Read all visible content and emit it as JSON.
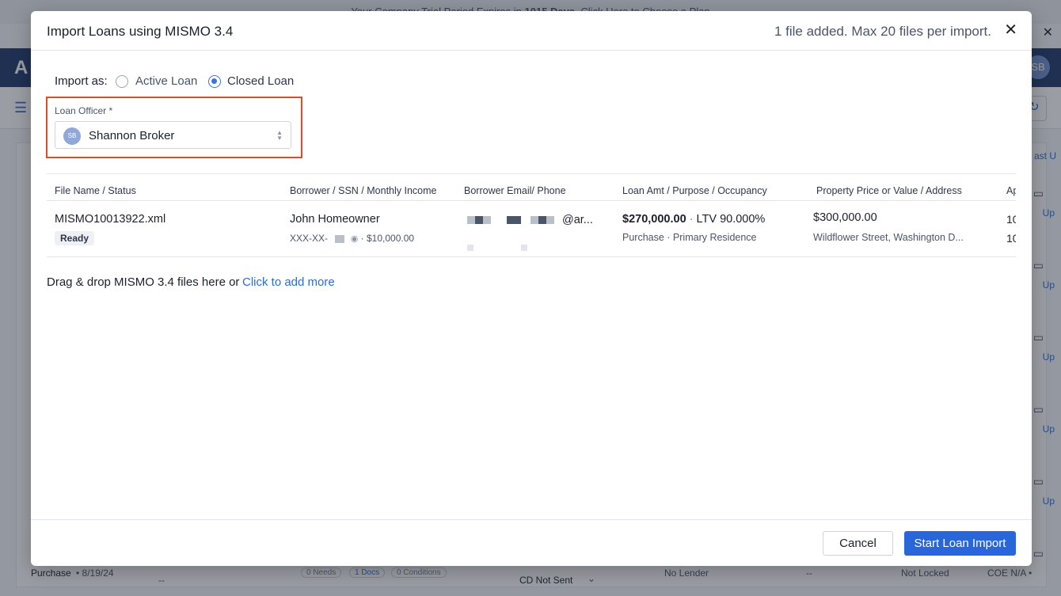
{
  "background": {
    "banner_pre": "Your Company Trial Period Expires in ",
    "banner_days": "1015 Days",
    "banner_post": ". Click Here to Choose a Plan",
    "brand_letter": "A",
    "avatar_initials": "SB",
    "last_u_link": "ast U",
    "side_link": "Up",
    "bottom_row": {
      "purpose": "Purchase",
      "date": " • 8/19/24",
      "dash1": "--",
      "needs": "0 Needs",
      "docs": "1 Docs",
      "conditions": "0 Conditions",
      "cd_status": "CD Not Sent",
      "lender": "No Lender",
      "dash2": "--",
      "lock": "Not Locked",
      "coe": "COE N/A •"
    }
  },
  "modal": {
    "title": "Import Loans using MISMO 3.4",
    "file_count": "1 file added. Max 20 files per import.",
    "close_glyph": "✕",
    "import_as": {
      "label": "Import as:",
      "options": [
        {
          "label": "Active Loan",
          "selected": false
        },
        {
          "label": "Closed Loan",
          "selected": true
        }
      ]
    },
    "loan_officer": {
      "label": "Loan Officer *",
      "initials": "SB",
      "value": "Shannon Broker"
    },
    "table": {
      "headers": [
        "File Name / Status",
        "Borrower / SSN / Monthly Income",
        "Borrower Email/ Phone",
        "Loan Amt / Purpose / Occupancy",
        "Property Price or Value / Address",
        "Ap"
      ],
      "rows": [
        {
          "file_name": "MISMO10013922.xml",
          "status": "Ready",
          "borrower": "John Homeowner",
          "ssn_prefix": "XXX-XX-",
          "income": "$10,000.00",
          "email_suffix": "@ar...",
          "loan_amount": "$270,000.00",
          "ltv": "LTV 90.000%",
          "purpose": "Purchase",
          "occupancy": "Primary Residence",
          "property_price": "$300,000.00",
          "address": "Wildflower Street, Washington D...",
          "ap_1": "10",
          "ap_2": "10"
        }
      ]
    },
    "dropzone": {
      "text": "Drag & drop MISMO 3.4 files here or",
      "link": "Click to add more"
    },
    "footer": {
      "cancel": "Cancel",
      "start": "Start Loan Import"
    }
  },
  "colors": {
    "primary": "#2866d9",
    "highlight_border": "#e04a2a",
    "nav": "#1f3a6e"
  }
}
